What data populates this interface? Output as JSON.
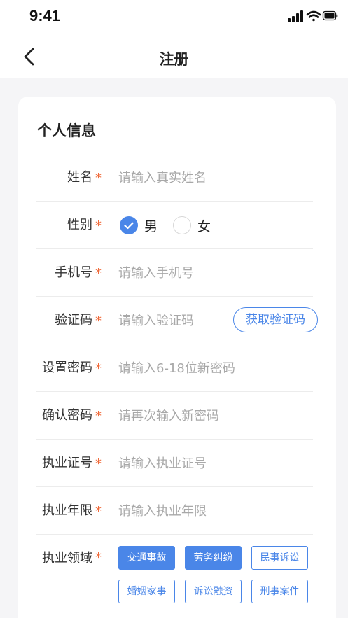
{
  "status_bar": {
    "time": "9:41"
  },
  "nav": {
    "title": "注册"
  },
  "form": {
    "section_title": "个人信息",
    "required_mark": "*",
    "name": {
      "label": "姓名",
      "placeholder": "请输入真实姓名"
    },
    "gender": {
      "label": "性别",
      "options": [
        "男",
        "女"
      ],
      "selected": "男"
    },
    "phone": {
      "label": "手机号",
      "placeholder": "请输入手机号"
    },
    "code": {
      "label": "验证码",
      "placeholder": "请输入验证码",
      "button": "获取验证码"
    },
    "password": {
      "label": "设置密码",
      "placeholder": "请输入6-18位新密码"
    },
    "confirm": {
      "label": "确认密码",
      "placeholder": "请再次输入新密码"
    },
    "license": {
      "label": "执业证号",
      "placeholder": "请输入执业证号"
    },
    "years": {
      "label": "执业年限",
      "placeholder": "请输入执业年限"
    },
    "domain": {
      "label": "执业领域",
      "tags": [
        {
          "text": "交通事故",
          "selected": true
        },
        {
          "text": "劳务纠纷",
          "selected": true
        },
        {
          "text": "民事诉讼",
          "selected": false
        },
        {
          "text": "婚姻家事",
          "selected": false
        },
        {
          "text": "诉讼融资",
          "selected": false
        },
        {
          "text": "刑事案件",
          "selected": false
        }
      ]
    }
  },
  "colors": {
    "accent": "#4a86e8",
    "required": "#f06a3a",
    "placeholder": "#a8a8a8"
  }
}
